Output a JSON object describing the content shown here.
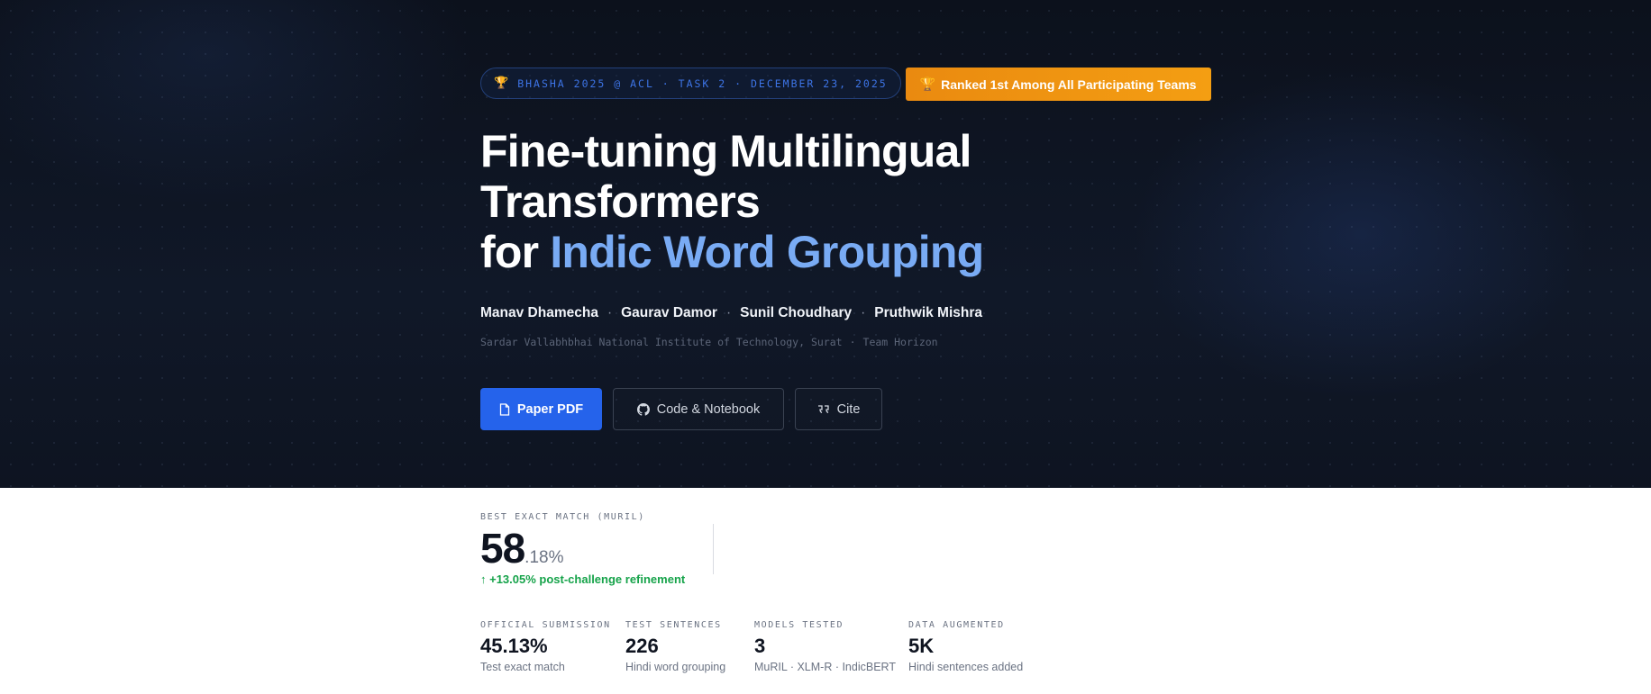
{
  "hero": {
    "event_badge": "BHASHA 2025 @ ACL · TASK 2 · DECEMBER 23, 2025",
    "rank_badge": "Ranked 1st Among All Participating Teams",
    "title_line1": "Fine-tuning Multilingual",
    "title_line2": "Transformers",
    "title_line3_prefix": "for ",
    "title_line3_accent": "Indic Word Grouping",
    "authors": [
      "Manav Dhamecha",
      "Gaurav Damor",
      "Sunil Choudhary",
      "Pruthwik Mishra"
    ],
    "author_separator": "·",
    "affiliation": "Sardar Vallabhbhai National Institute of Technology, Surat",
    "affiliation_separator": "·",
    "team": "Team Horizon",
    "buttons": {
      "paper": "Paper PDF",
      "code": "Code & Notebook",
      "cite": "Cite"
    }
  },
  "stats": {
    "best_label": "BEST EXACT MATCH (MURIL)",
    "best_int": "58",
    "best_dec": ".18%",
    "improvement": "↑ +13.05% post-challenge refinement",
    "metrics": [
      {
        "label": "OFFICIAL SUBMISSION",
        "value": "45.13%",
        "sub": "Test exact match"
      },
      {
        "label": "TEST SENTENCES",
        "value": "226",
        "sub": "Hindi word grouping"
      },
      {
        "label": "MODELS TESTED",
        "value": "3",
        "sub": "MuRIL · XLM-R · IndicBERT"
      },
      {
        "label": "DATA AUGMENTED",
        "value": "5K",
        "sub": "Hindi sentences added"
      }
    ]
  },
  "icons": {
    "trophy": "trophy-icon",
    "file": "file-icon",
    "github": "github-icon",
    "quote": "quote-icon"
  },
  "colors": {
    "accent": "#79abf4",
    "primary_button": "#2563eb",
    "rank_badge": "#f49e12",
    "improvement": "#16a34a"
  }
}
